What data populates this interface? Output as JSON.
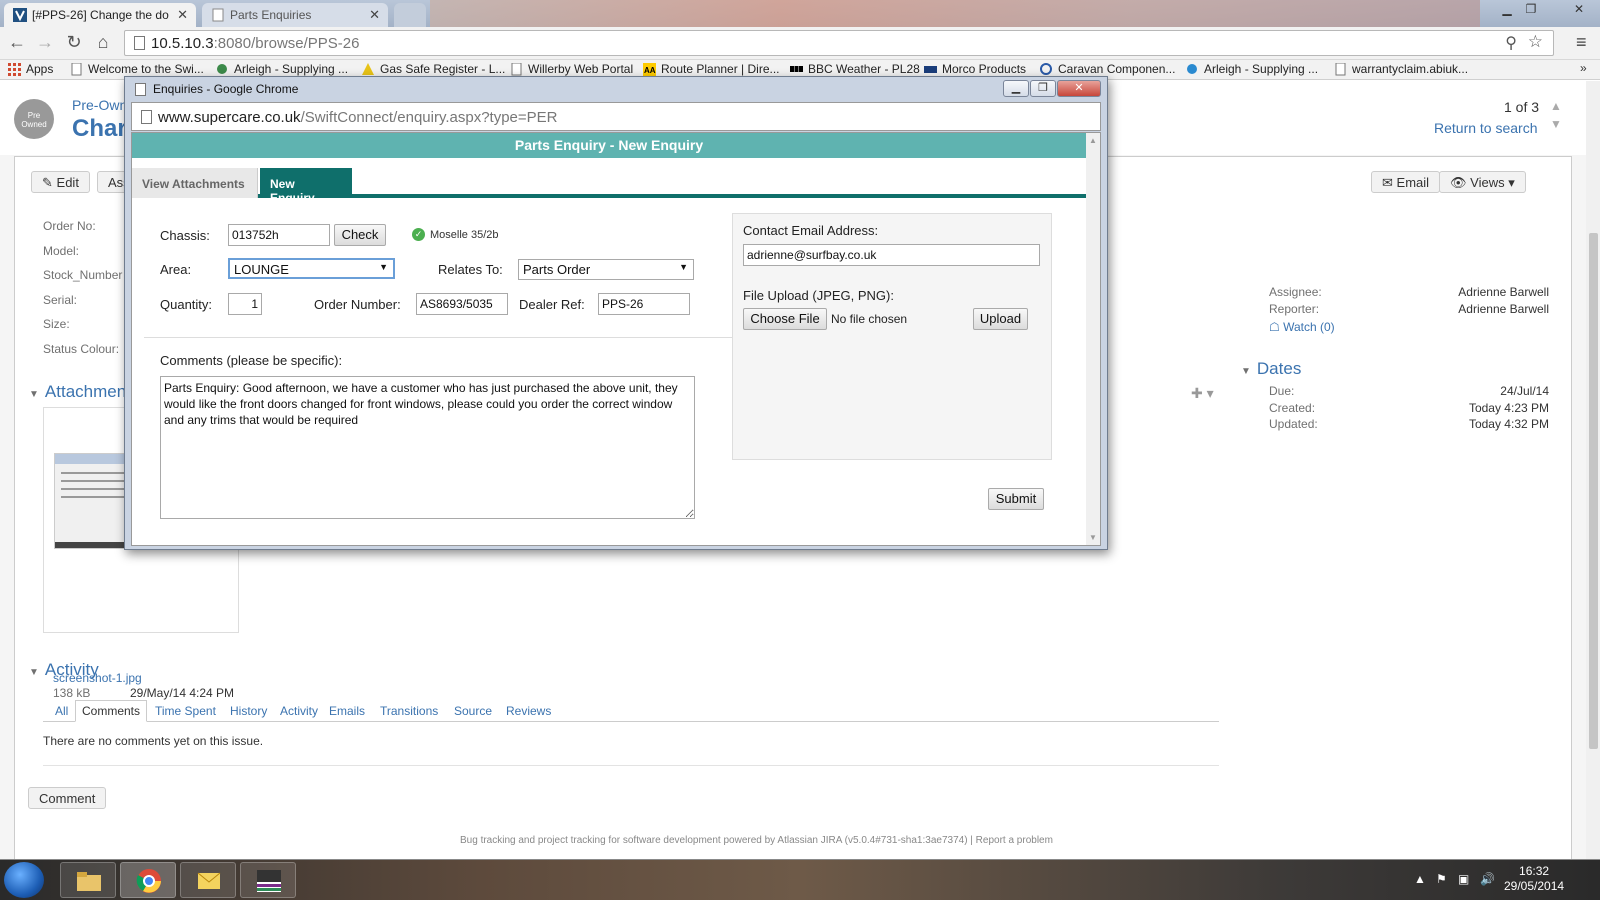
{
  "browser": {
    "tabs": [
      {
        "title": "[#PPS-26] Change the do",
        "active": true
      },
      {
        "title": "Parts Enquiries",
        "active": false
      }
    ],
    "url_host": "10.5.10.3",
    "url_rest": ":8080/browse/PPS-26",
    "bookmarks": [
      "Apps",
      "Welcome to the Swi...",
      "Arleigh - Supplying ...",
      "Gas Safe Register - L...",
      "Willerby Web Portal",
      "Route Planner | Dire...",
      "BBC Weather - PL28",
      "Morco Products",
      "Caravan Componen...",
      "Arleigh - Supplying ...",
      "warrantyclaim.abiuk..."
    ],
    "more": "»"
  },
  "jira": {
    "project_link": "Pre-Own",
    "avatar_text": "Pre Owned",
    "title": "Char",
    "pager": "1 of 3",
    "return_to_search": "Return to search",
    "edit_label": "Edit",
    "assign_label": "Ass",
    "email_label": "Email",
    "views_label": "Views",
    "fields": [
      "Order No:",
      "Model:",
      "Stock_Number",
      "Serial:",
      "Size:",
      "Status Colour:"
    ],
    "people": {
      "assignee_label": "Assignee:",
      "assignee": "Adrienne Barwell",
      "reporter_label": "Reporter:",
      "reporter": "Adrienne Barwell",
      "watch": "Watch (0)"
    },
    "dates": {
      "heading": "Dates",
      "due_label": "Due:",
      "due": "24/Jul/14",
      "created_label": "Created:",
      "created": "Today 4:23 PM",
      "updated_label": "Updated:",
      "updated": "Today 4:32 PM"
    },
    "attachments": {
      "heading": "Attachment",
      "file_name": "screenshot-1.jpg",
      "file_size": "138 kB",
      "file_date": "29/May/14 4:24 PM"
    },
    "activity": {
      "heading": "Activity",
      "tabs": [
        "All",
        "Comments",
        "Time Spent",
        "History",
        "Activity",
        "Emails",
        "Transitions",
        "Source",
        "Reviews"
      ],
      "selected_tab": "Comments",
      "empty_text": "There are no comments yet on this issue.",
      "comment_button": "Comment"
    },
    "footer": "Bug tracking and project tracking for software development powered by Atlassian JIRA (v5.0.4#731-sha1:3ae7374)  |  Report a problem"
  },
  "popup": {
    "window_title": "Enquiries - Google Chrome",
    "url_host": "www.supercare.co.uk",
    "url_rest": "/SwiftConnect/enquiry.aspx?type=PER",
    "header": "Parts Enquiry - New Enquiry",
    "tabs": [
      "View Attachments",
      "New Enquiry"
    ],
    "form": {
      "chassis_label": "Chassis:",
      "chassis_value": "013752h",
      "check_button": "Check",
      "model_text": "Moselle 35/2b",
      "area_label": "Area:",
      "area_value": "LOUNGE",
      "relates_label": "Relates To:",
      "relates_value": "Parts Order",
      "quantity_label": "Quantity:",
      "quantity_value": "1",
      "order_number_label": "Order Number:",
      "order_number_value": "AS8693/5035",
      "dealer_ref_label": "Dealer Ref:",
      "dealer_ref_value": "PPS-26",
      "comments_label": "Comments (please be specific):",
      "comments_value": "Parts Enquiry: Good afternoon, we have a customer who has just purchased the above unit, they would like the front doors changed for front windows, please could you order the correct window and any trims that would be required",
      "email_label": "Contact Email Address:",
      "email_value": "adrienne@surfbay.co.uk",
      "upload_label": "File Upload (JPEG, PNG):",
      "choose_file": "Choose File",
      "no_file": "No file chosen",
      "upload_button": "Upload",
      "submit_button": "Submit"
    }
  },
  "taskbar": {
    "time": "16:32",
    "date": "29/05/2014"
  },
  "colors": {
    "jira_link": "#3b73af",
    "popup_header": "#5fb3b0",
    "popup_tab_active": "#0f6f6b"
  }
}
